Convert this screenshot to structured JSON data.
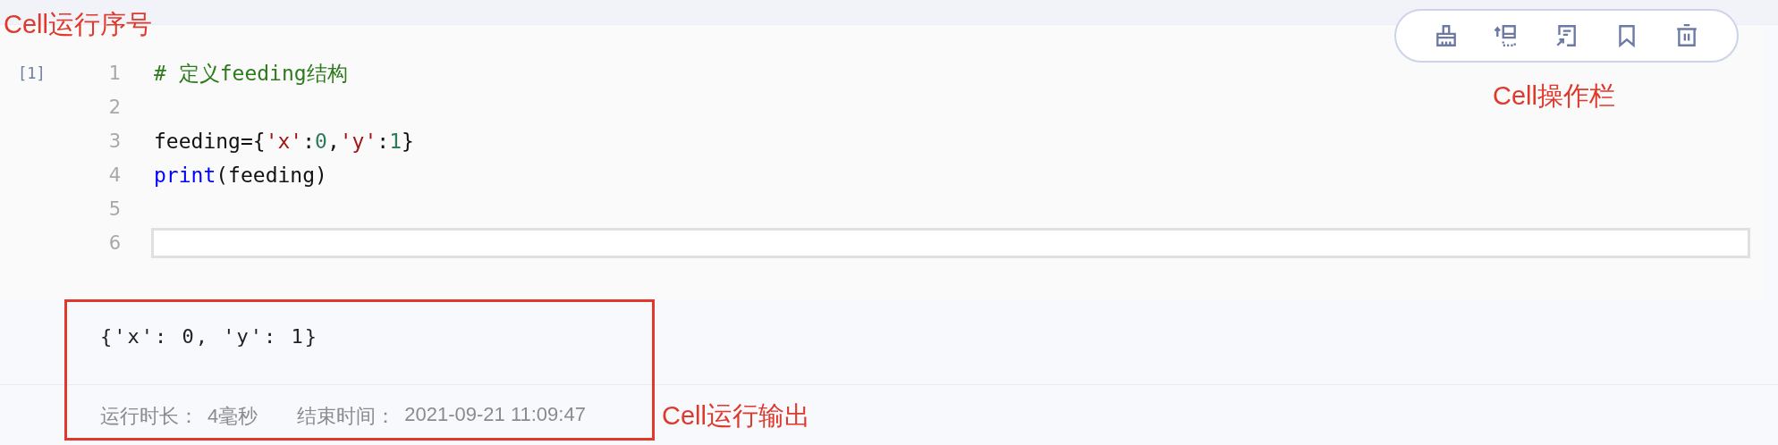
{
  "annotations": {
    "cell_number_label": "Cell运行序号",
    "toolbar_label": "Cell操作栏",
    "output_label": "Cell运行输出"
  },
  "cell": {
    "execution_count": "[1]",
    "lines": [
      {
        "number": "1",
        "active": false,
        "tokens": [
          {
            "kind": "comment",
            "text": "# 定义feeding结构"
          }
        ]
      },
      {
        "number": "2",
        "active": false
      },
      {
        "number": "3",
        "active": false,
        "tokens": [
          {
            "kind": "plain",
            "text": "feeding={"
          },
          {
            "kind": "string",
            "text": "'x'"
          },
          {
            "kind": "plain",
            "text": ":"
          },
          {
            "kind": "number",
            "text": "0"
          },
          {
            "kind": "plain",
            "text": ","
          },
          {
            "kind": "string",
            "text": "'y'"
          },
          {
            "kind": "plain",
            "text": ":"
          },
          {
            "kind": "number",
            "text": "1"
          },
          {
            "kind": "plain",
            "text": "}"
          }
        ]
      },
      {
        "number": "4",
        "active": false,
        "tokens": [
          {
            "kind": "keyword",
            "text": "print"
          },
          {
            "kind": "plain",
            "text": "(feeding)"
          }
        ]
      },
      {
        "number": "5",
        "active": false
      },
      {
        "number": "6",
        "active": true
      }
    ]
  },
  "output": {
    "text": "{'x': 0, 'y': 1}",
    "meta": [
      {
        "label": "运行时长：",
        "value": "4毫秒"
      },
      {
        "label": "结束时间：",
        "value": "2021-09-21 11:09:47"
      }
    ]
  }
}
